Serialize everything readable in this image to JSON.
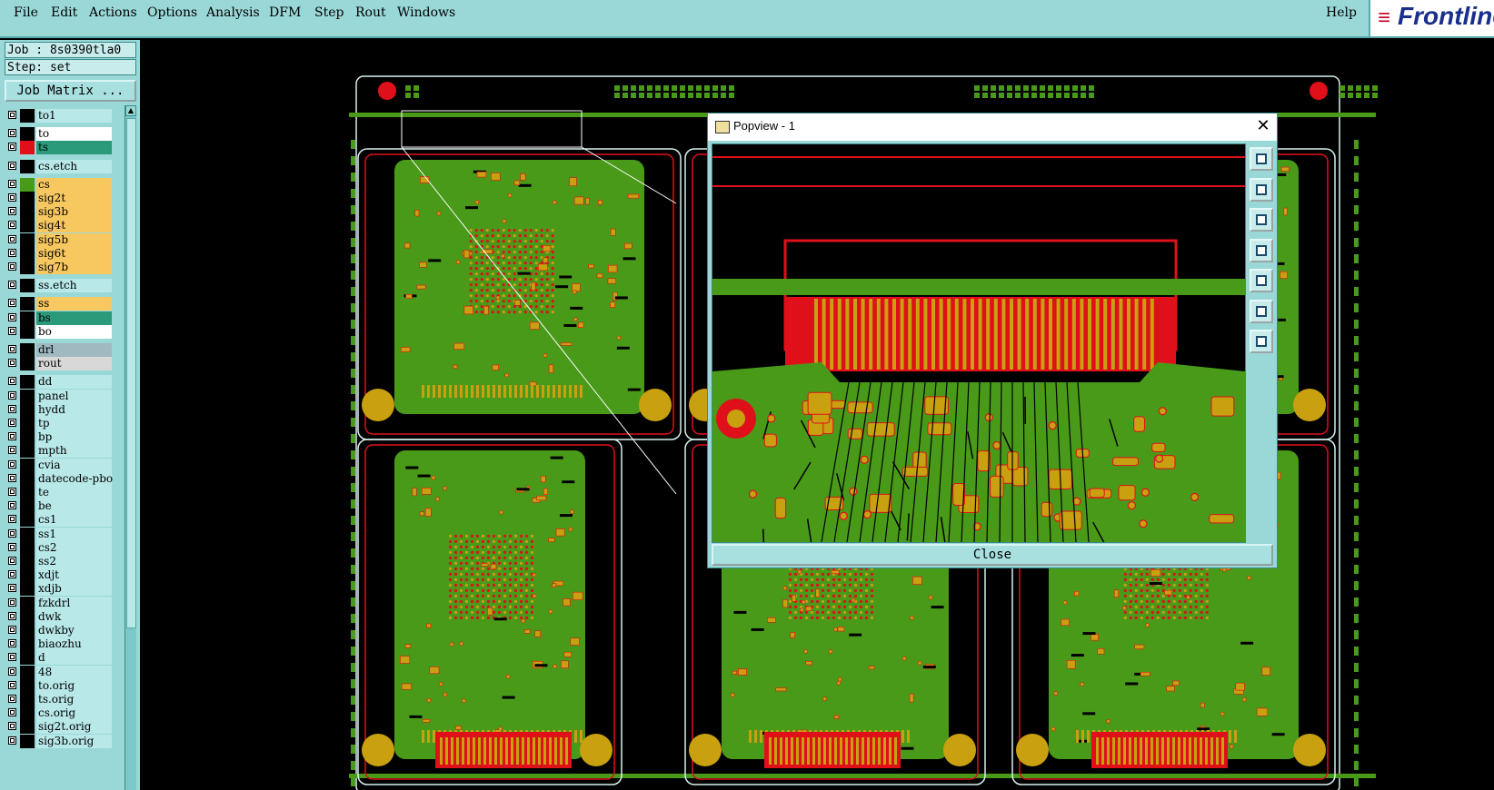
{
  "menubar": {
    "items": [
      "File",
      "Edit",
      "Actions",
      "Options",
      "Analysis",
      "DFM",
      "Step",
      "Rout",
      "Windows"
    ],
    "help": "Help",
    "logo_text": "Frontline"
  },
  "job": {
    "job_line": "Job : 8s0390tla0",
    "step_line": "Step: set",
    "matrix_button": "Job Matrix ..."
  },
  "layers": [
    {
      "name": "to1",
      "color": "#b8e8e8",
      "swatch": "#000000"
    },
    {
      "name": "to",
      "color": "#ffffff",
      "swatch": "#000000"
    },
    {
      "name": "ts",
      "color": "#2a9a7a",
      "swatch": "#e0101a",
      "active": true
    },
    {
      "name": "cs.etch",
      "color": "#b8e8e8",
      "swatch": "#000000"
    },
    {
      "name": "cs",
      "color": "#f8c860",
      "swatch": "#4a9a1a"
    },
    {
      "name": "sig2t",
      "color": "#f8c860",
      "swatch": "#000000"
    },
    {
      "name": "sig3b",
      "color": "#f8c860",
      "swatch": "#000000"
    },
    {
      "name": "sig4t",
      "color": "#f8c860",
      "swatch": "#000000"
    },
    {
      "name": "sig5b",
      "color": "#f8c860",
      "swatch": "#000000"
    },
    {
      "name": "sig6t",
      "color": "#f8c860",
      "swatch": "#000000"
    },
    {
      "name": "sig7b",
      "color": "#f8c860",
      "swatch": "#000000"
    },
    {
      "name": "ss.etch",
      "color": "#b8e8e8",
      "swatch": "#000000"
    },
    {
      "name": "ss",
      "color": "#f8c860",
      "swatch": "#000000"
    },
    {
      "name": "bs",
      "color": "#2a9a7a",
      "swatch": "#000000"
    },
    {
      "name": "bo",
      "color": "#ffffff",
      "swatch": "#000000"
    },
    {
      "name": "drl",
      "color": "#a0b8c0",
      "swatch": "#000000"
    },
    {
      "name": "rout",
      "color": "#d8d8d8",
      "swatch": "#000000"
    },
    {
      "name": "dd",
      "color": "#b8e8e8",
      "swatch": "#000000"
    },
    {
      "name": "panel",
      "color": "#b8e8e8",
      "swatch": "#000000"
    },
    {
      "name": "hydd",
      "color": "#b8e8e8",
      "swatch": "#000000"
    },
    {
      "name": "tp",
      "color": "#b8e8e8",
      "swatch": "#000000"
    },
    {
      "name": "bp",
      "color": "#b8e8e8",
      "swatch": "#000000"
    },
    {
      "name": "mpth",
      "color": "#b8e8e8",
      "swatch": "#000000"
    },
    {
      "name": "cvia",
      "color": "#b8e8e8",
      "swatch": "#000000"
    },
    {
      "name": "datecode-pbo",
      "color": "#b8e8e8",
      "swatch": "#000000"
    },
    {
      "name": "te",
      "color": "#b8e8e8",
      "swatch": "#000000"
    },
    {
      "name": "be",
      "color": "#b8e8e8",
      "swatch": "#000000"
    },
    {
      "name": "cs1",
      "color": "#b8e8e8",
      "swatch": "#000000"
    },
    {
      "name": "ss1",
      "color": "#b8e8e8",
      "swatch": "#000000"
    },
    {
      "name": "cs2",
      "color": "#b8e8e8",
      "swatch": "#000000"
    },
    {
      "name": "ss2",
      "color": "#b8e8e8",
      "swatch": "#000000"
    },
    {
      "name": "xdjt",
      "color": "#b8e8e8",
      "swatch": "#000000"
    },
    {
      "name": "xdjb",
      "color": "#b8e8e8",
      "swatch": "#000000"
    },
    {
      "name": "fzkdrl",
      "color": "#b8e8e8",
      "swatch": "#000000"
    },
    {
      "name": "dwk",
      "color": "#b8e8e8",
      "swatch": "#000000"
    },
    {
      "name": "dwkby",
      "color": "#b8e8e8",
      "swatch": "#000000"
    },
    {
      "name": "biaozhu",
      "color": "#b8e8e8",
      "swatch": "#000000"
    },
    {
      "name": "d",
      "color": "#b8e8e8",
      "swatch": "#000000"
    },
    {
      "name": "48",
      "color": "#b8e8e8",
      "swatch": "#000000"
    },
    {
      "name": "to.orig",
      "color": "#b8e8e8",
      "swatch": "#000000"
    },
    {
      "name": "ts.orig",
      "color": "#b8e8e8",
      "swatch": "#000000"
    },
    {
      "name": "cs.orig",
      "color": "#b8e8e8",
      "swatch": "#000000"
    },
    {
      "name": "sig2t.orig",
      "color": "#b8e8e8",
      "swatch": "#000000"
    },
    {
      "name": "sig3b.orig",
      "color": "#b8e8e8",
      "swatch": "#000000"
    }
  ],
  "popview": {
    "title": "Popview - 1",
    "close_label": "Close",
    "tools": [
      "zoom-fit-icon",
      "pan-up-icon",
      "pan-down-icon",
      "pan-left-icon",
      "pan-right-icon",
      "zoom-in-icon",
      "zoom-out-icon"
    ]
  },
  "colors": {
    "panel_bg": "#9ad8d8",
    "copper": "#4a9a1a",
    "pad": "#c8a010",
    "outline": "#e0101a",
    "board_edge": "#d8f0f0"
  }
}
